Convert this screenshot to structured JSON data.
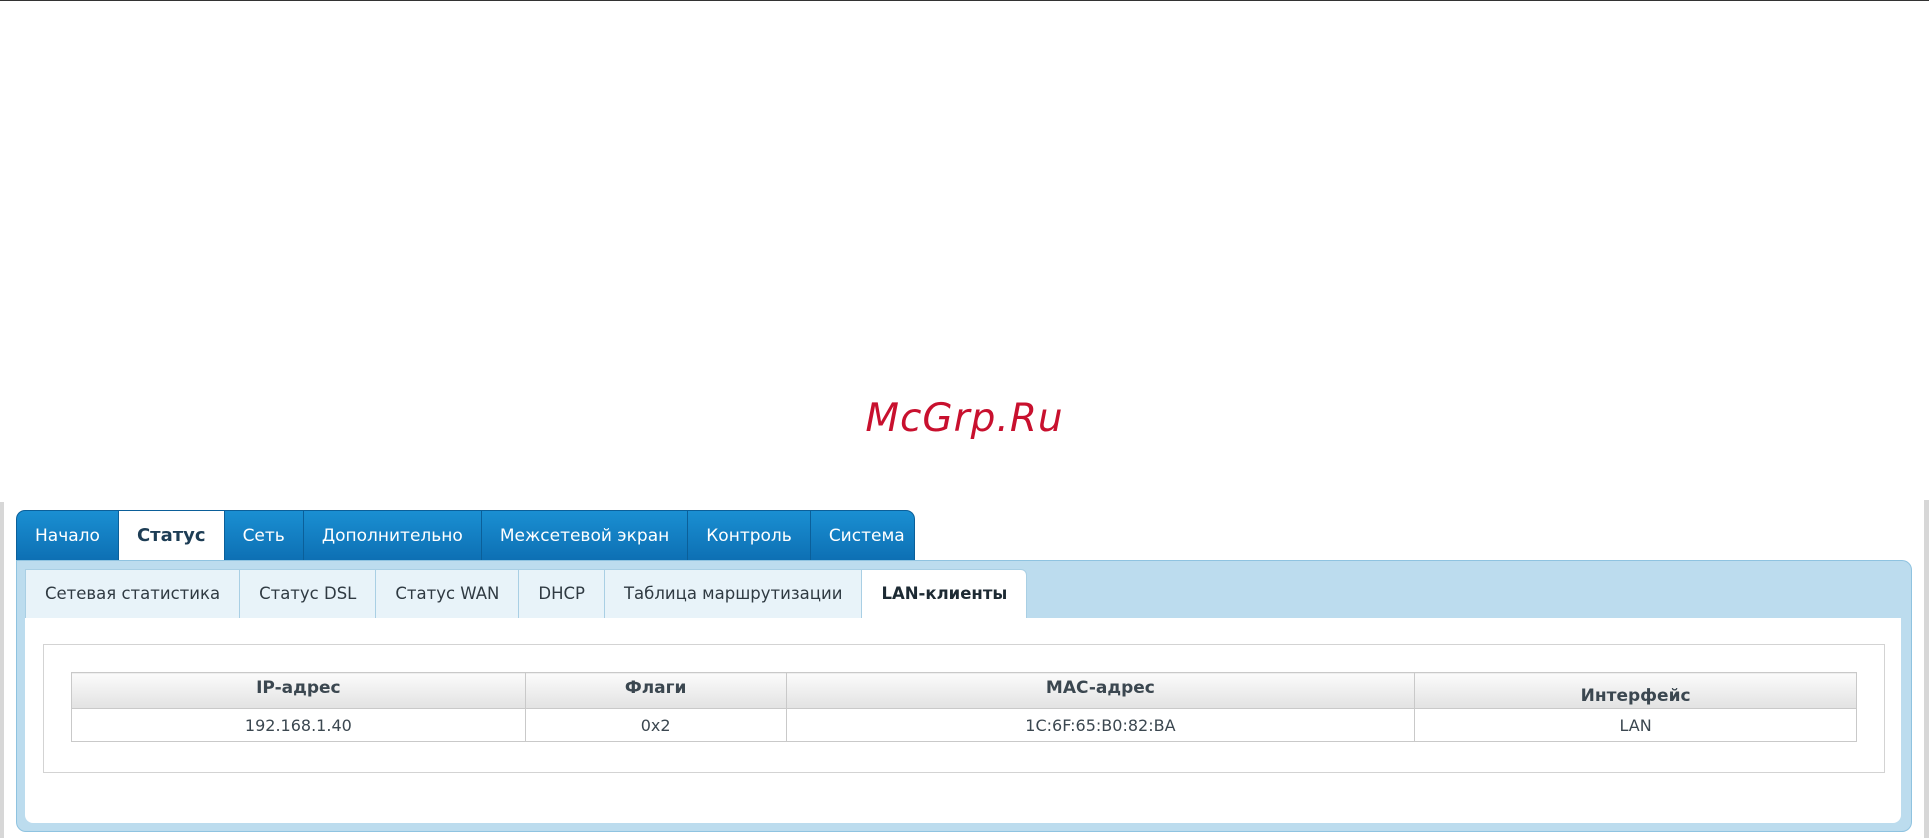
{
  "watermark": "McGrp.Ru",
  "main_tabs": [
    {
      "label": "Начало",
      "active": false
    },
    {
      "label": "Статус",
      "active": true
    },
    {
      "label": "Сеть",
      "active": false
    },
    {
      "label": "Дополнительно",
      "active": false
    },
    {
      "label": "Межсетевой экран",
      "active": false
    },
    {
      "label": "Контроль",
      "active": false
    },
    {
      "label": "Система",
      "active": false
    }
  ],
  "sub_tabs": [
    {
      "label": "Сетевая статистика",
      "active": false
    },
    {
      "label": "Статус DSL",
      "active": false
    },
    {
      "label": "Статус WAN",
      "active": false
    },
    {
      "label": "DHCP",
      "active": false
    },
    {
      "label": "Таблица маршрутизации",
      "active": false
    },
    {
      "label": "LAN-клиенты",
      "active": true
    }
  ],
  "table": {
    "headers": {
      "ip": "IP-адрес",
      "flags": "Флаги",
      "mac": "MAC-адрес",
      "interface": "Интерфейс"
    },
    "rows": [
      {
        "ip": "192.168.1.40",
        "flags": "0x2",
        "mac": "1C:6F:65:B0:82:BA",
        "interface": "LAN"
      }
    ]
  },
  "colors": {
    "nav_blue": "#1a8fd2",
    "panel_blue": "#bcdcee",
    "watermark_red": "#c8102e"
  }
}
